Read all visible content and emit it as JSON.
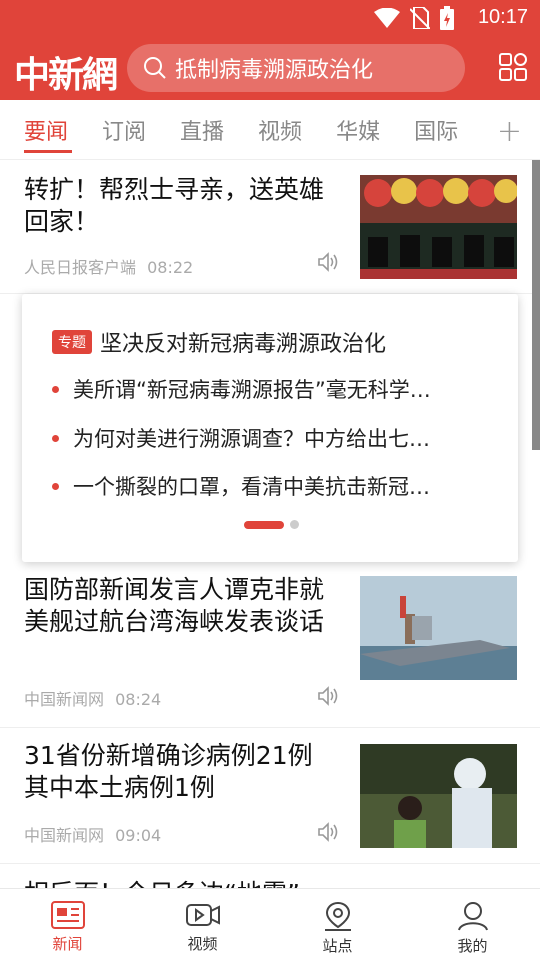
{
  "status": {
    "time": "10:17"
  },
  "header": {
    "logo": "中新網",
    "search_text": "抵制病毒溯源政治化"
  },
  "tabs": [
    "要闻",
    "订阅",
    "直播",
    "视频",
    "华媒",
    "国际"
  ],
  "tab_plus": "+",
  "news": [
    {
      "title": "转扩！帮烈士寻亲，送英雄回家！",
      "source": "人民日报客户端",
      "time": "08:22"
    },
    {
      "title": "国防部新闻发言人谭克非就美舰过航台湾海峡发表谈话",
      "source": "中国新闻网",
      "time": "08:24"
    },
    {
      "title": "31省份新增确诊病例21例其中本土病例1例",
      "source": "中国新闻网",
      "time": "09:04"
    }
  ],
  "card": {
    "badge": "专题",
    "title": "坚决反对新冠病毒溯源政治化",
    "items": [
      "美所谓“新冠病毒溯源报告”毫无科学…",
      "为何对美进行溯源调查？中方给出七…",
      "一个撕裂的口罩，看清中美抗击新冠…"
    ]
  },
  "partial_title": "相后面！今日多边“地震”",
  "bottom_nav": [
    {
      "label": "新闻",
      "icon": "news-icon",
      "active": true
    },
    {
      "label": "视频",
      "icon": "video-icon",
      "active": false
    },
    {
      "label": "站点",
      "icon": "location-icon",
      "active": false
    },
    {
      "label": "我的",
      "icon": "profile-icon",
      "active": false
    }
  ],
  "colors": {
    "brand": "#e0443a"
  }
}
